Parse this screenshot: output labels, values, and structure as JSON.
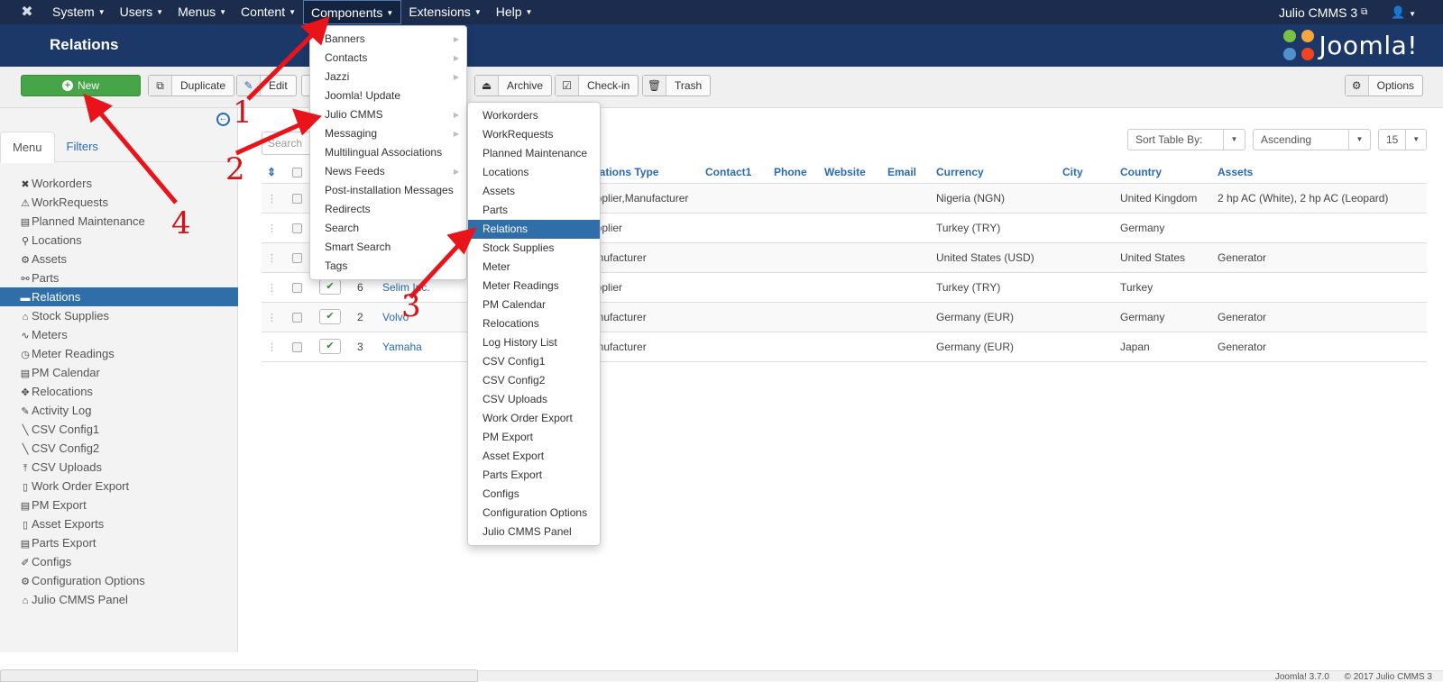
{
  "topnav": {
    "menu": [
      "System",
      "Users",
      "Menus",
      "Content",
      "Components",
      "Extensions",
      "Help"
    ],
    "active_menu": "Components",
    "site_name": "Julio CMMS 3",
    "user_icon": "user-icon"
  },
  "header": {
    "title": "Relations",
    "brand": "Joomla!"
  },
  "toolbar": {
    "new": "New",
    "duplicate": "Duplicate",
    "edit": "Edit",
    "archive": "Archive",
    "checkin": "Check-in",
    "trash": "Trash",
    "options": "Options"
  },
  "sidebar": {
    "tabs": [
      "Menu",
      "Filters"
    ],
    "items": [
      {
        "label": "Workorders",
        "icon": "✖"
      },
      {
        "label": "WorkRequests",
        "icon": "⚠"
      },
      {
        "label": "Planned Maintenance",
        "icon": "▤"
      },
      {
        "label": "Locations",
        "icon": "⚲"
      },
      {
        "label": "Assets",
        "icon": "⚙"
      },
      {
        "label": "Parts",
        "icon": "⚯"
      },
      {
        "label": "Relations",
        "icon": "▬"
      },
      {
        "label": "Stock Supplies",
        "icon": "⌂"
      },
      {
        "label": "Meters",
        "icon": "∿"
      },
      {
        "label": "Meter Readings",
        "icon": "◷"
      },
      {
        "label": "PM Calendar",
        "icon": "▤"
      },
      {
        "label": "Relocations",
        "icon": "✥"
      },
      {
        "label": "Activity Log",
        "icon": "✎"
      },
      {
        "label": "CSV Config1",
        "icon": "╲"
      },
      {
        "label": "CSV Config2",
        "icon": "╲"
      },
      {
        "label": "CSV Uploads",
        "icon": "⤒"
      },
      {
        "label": "Work Order Export",
        "icon": "▯"
      },
      {
        "label": "PM Export",
        "icon": "▤"
      },
      {
        "label": "Asset Exports",
        "icon": "▯"
      },
      {
        "label": "Parts Export",
        "icon": "▤"
      },
      {
        "label": "Configs",
        "icon": "✐"
      },
      {
        "label": "Configuration Options",
        "icon": "⚙"
      },
      {
        "label": "Julio CMMS Panel",
        "icon": "⌂"
      }
    ],
    "active": "Relations"
  },
  "filters": {
    "search_placeholder": "Search",
    "sort_by": "Sort Table By:",
    "order": "Ascending",
    "limit": "15"
  },
  "table": {
    "columns": [
      "",
      "",
      "",
      "",
      "",
      "Relations Type",
      "Contact1",
      "Phone",
      "Website",
      "Email",
      "Currency",
      "City",
      "Country",
      "Assets"
    ],
    "rows": [
      {
        "id": "",
        "name": "",
        "type": "Supplier,Manufacturer",
        "currency": "Nigeria (NGN)",
        "country": "United Kingdom",
        "assets": "2 hp AC (White), 2 hp AC (Leopard)"
      },
      {
        "id": "",
        "name": "",
        "type": "Supplier",
        "currency": "Turkey (TRY)",
        "country": "Germany",
        "assets": ""
      },
      {
        "id": "",
        "name": "",
        "type": "Manufacturer",
        "currency": "United States (USD)",
        "country": "United States",
        "assets": "Generator"
      },
      {
        "id": "6",
        "name": "Selim Inc.",
        "type": "Supplier",
        "currency": "Turkey (TRY)",
        "country": "Turkey",
        "assets": ""
      },
      {
        "id": "2",
        "name": "Volvo",
        "type": "Manufacturer",
        "currency": "Germany (EUR)",
        "country": "Germany",
        "assets": "Generator"
      },
      {
        "id": "3",
        "name": "Yamaha",
        "type": "Manufacturer",
        "currency": "Germany (EUR)",
        "country": "Japan",
        "assets": "Generator"
      }
    ]
  },
  "components_menu": [
    {
      "label": "Banners",
      "sub": true
    },
    {
      "label": "Contacts",
      "sub": true
    },
    {
      "label": "Jazzi",
      "sub": true
    },
    {
      "label": "Joomla! Update",
      "sub": false
    },
    {
      "label": "Julio CMMS",
      "sub": true
    },
    {
      "label": "Messaging",
      "sub": true
    },
    {
      "label": "Multilingual Associations",
      "sub": false
    },
    {
      "label": "News Feeds",
      "sub": true
    },
    {
      "label": "Post-installation Messages",
      "sub": false
    },
    {
      "label": "Redirects",
      "sub": false
    },
    {
      "label": "Search",
      "sub": false
    },
    {
      "label": "Smart Search",
      "sub": false
    },
    {
      "label": "Tags",
      "sub": false
    }
  ],
  "julio_submenu": [
    "Workorders",
    "WorkRequests",
    "Planned Maintenance",
    "Locations",
    "Assets",
    "Parts",
    "Relations",
    "Stock Supplies",
    "Meter",
    "Meter Readings",
    "PM Calendar",
    "Relocations",
    "Log History List",
    "CSV Config1",
    "CSV Config2",
    "CSV Uploads",
    "Work Order Export",
    "PM Export",
    "Asset Export",
    "Parts Export",
    "Configs",
    "Configuration Options",
    "Julio CMMS Panel"
  ],
  "julio_submenu_active": "Relations",
  "annotations": [
    "1",
    "2",
    "3",
    "4"
  ],
  "footer": {
    "version": "Joomla! 3.7.0",
    "copyright": "© 2017 Julio CMMS 3"
  }
}
